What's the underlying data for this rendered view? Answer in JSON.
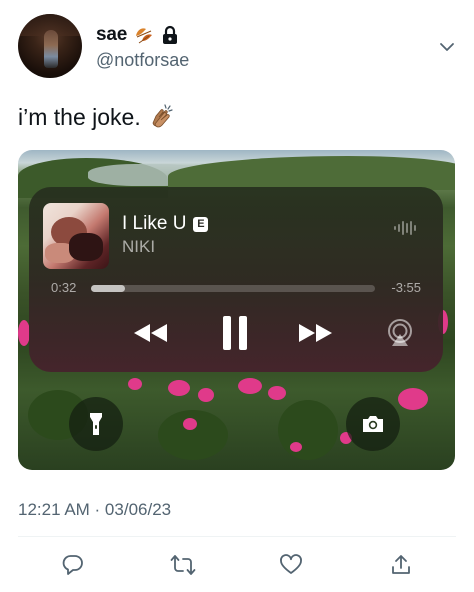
{
  "author": {
    "display_name": "sae",
    "handle": "@notforsae",
    "name_emoji_icon": "fallen-leaf-icon",
    "protected_icon": "lock-icon"
  },
  "tweet": {
    "text": "i’m the joke.",
    "emoji_icon": "clapping-hands-icon",
    "timestamp": "12:21 AM · 03/06/23"
  },
  "now_playing": {
    "title": "I Like U",
    "explicit": "E",
    "artist": "NIKI",
    "elapsed": "0:32",
    "remaining": "-3:55",
    "progress": 0.12
  },
  "lockscreen": {
    "left_button_icon": "flashlight-icon",
    "right_button_icon": "camera-icon"
  },
  "actions": [
    "reply-icon",
    "retweet-icon",
    "like-icon",
    "share-icon"
  ],
  "colors": {
    "handle": "#536471",
    "text": "#0f1419",
    "player_bg": "#2e2822"
  }
}
